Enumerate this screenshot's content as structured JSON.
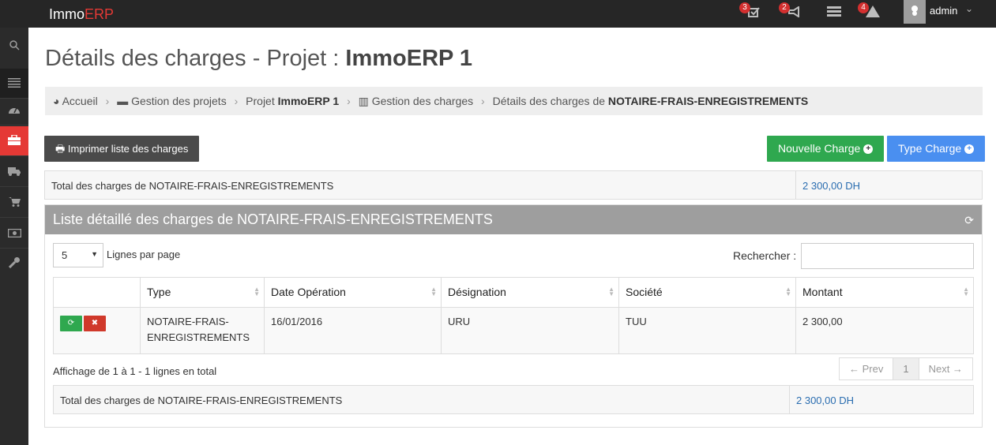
{
  "brand": {
    "immo": "Immo",
    "erp": "ERP"
  },
  "topbar": {
    "icons": [
      {
        "name": "tasks-icon",
        "badge": "3"
      },
      {
        "name": "megaphone-icon",
        "badge": "2"
      },
      {
        "name": "server-icon",
        "badge": ""
      },
      {
        "name": "warning-icon",
        "badge": "4"
      }
    ],
    "user": "admin"
  },
  "sidebar": {
    "items": [
      {
        "name": "search-icon",
        "active": false
      },
      {
        "name": "menu-icon",
        "active": false
      },
      {
        "name": "dashboard-icon",
        "active": false
      },
      {
        "name": "briefcase-icon",
        "active": true
      },
      {
        "name": "truck-icon",
        "active": false
      },
      {
        "name": "cart-icon",
        "active": false
      },
      {
        "name": "money-icon",
        "active": false
      },
      {
        "name": "wrench-icon",
        "active": false
      }
    ]
  },
  "page": {
    "title_prefix": "Détails des charges - Projet : ",
    "title_project": "ImmoERP 1"
  },
  "breadcrumb": {
    "home": "Accueil",
    "projects": "Gestion des projets",
    "project_prefix": "Projet ",
    "project_name": "ImmoERP 1",
    "charges": "Gestion des charges",
    "current_prefix": "Détails des charges de ",
    "current_name": "NOTAIRE-FRAIS-ENREGISTREMENTS"
  },
  "toolbar": {
    "print_label": "Imprimer liste des charges",
    "new_charge_label": "Nouvelle Charge",
    "type_charge_label": "Type Charge"
  },
  "summary": {
    "label": "Total des charges de NOTAIRE-FRAIS-ENREGISTREMENTS",
    "value": "2 300,00 DH"
  },
  "panel": {
    "title": "Liste détaillé des charges de NOTAIRE-FRAIS-ENREGISTREMENTS",
    "page_length": "5",
    "page_length_label": "Lignes par page",
    "search_label": "Rechercher :",
    "search_value": ""
  },
  "table": {
    "headers": [
      "",
      "Type",
      "Date Opération",
      "Désignation",
      "Société",
      "Montant"
    ],
    "rows": [
      {
        "type": "NOTAIRE-FRAIS-ENREGISTREMENTS",
        "date": "16/01/2016",
        "designation": "URU",
        "societe": "TUU",
        "montant": "2 300,00"
      }
    ]
  },
  "pagination": {
    "info": "Affichage de 1 à 1 - 1 lignes en total",
    "prev": "← Prev",
    "current": "1",
    "next": "Next →"
  },
  "footer_total": {
    "label": "Total des charges de NOTAIRE-FRAIS-ENREGISTREMENTS",
    "value": "2 300,00 DH"
  },
  "colors": {
    "accent_red": "#e53935",
    "green": "#2fa84f",
    "blue": "#4a8ff0",
    "link_blue": "#2a6db0"
  }
}
